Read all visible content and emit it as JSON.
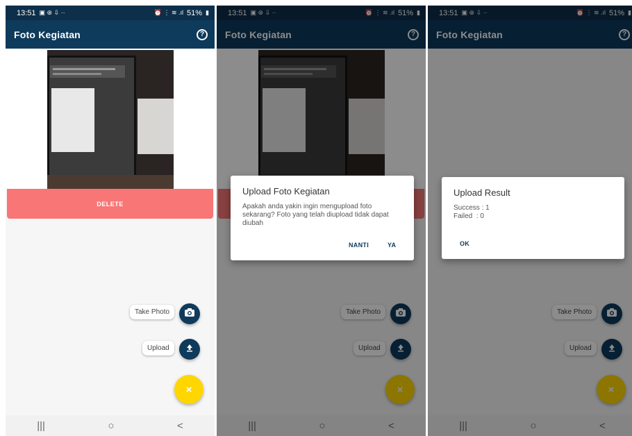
{
  "status": {
    "time": "13:51",
    "battery": "51%"
  },
  "app": {
    "title": "Foto Kegiatan",
    "help_icon": "?"
  },
  "main": {
    "delete_label": "DELETE"
  },
  "fab": {
    "take_photo_label": "Take Photo",
    "upload_label": "Upload",
    "close_symbol": "×",
    "primary_color": "#ffd600",
    "accent_color": "#0e3a5c"
  },
  "confirm_dialog": {
    "title": "Upload Foto Kegiatan",
    "message": "Apakah anda yakin ingin mengupload foto sekarang? Foto yang telah diupload tidak dapat diubah",
    "cancel_label": "NANTI",
    "ok_label": "YA"
  },
  "result_dialog": {
    "title": "Upload Result",
    "success_line": "Success : 1",
    "failed_line": "Failed  : 0",
    "ok_label": "OK"
  },
  "nav": {
    "recent": "|||",
    "home": "○",
    "back": "<"
  }
}
